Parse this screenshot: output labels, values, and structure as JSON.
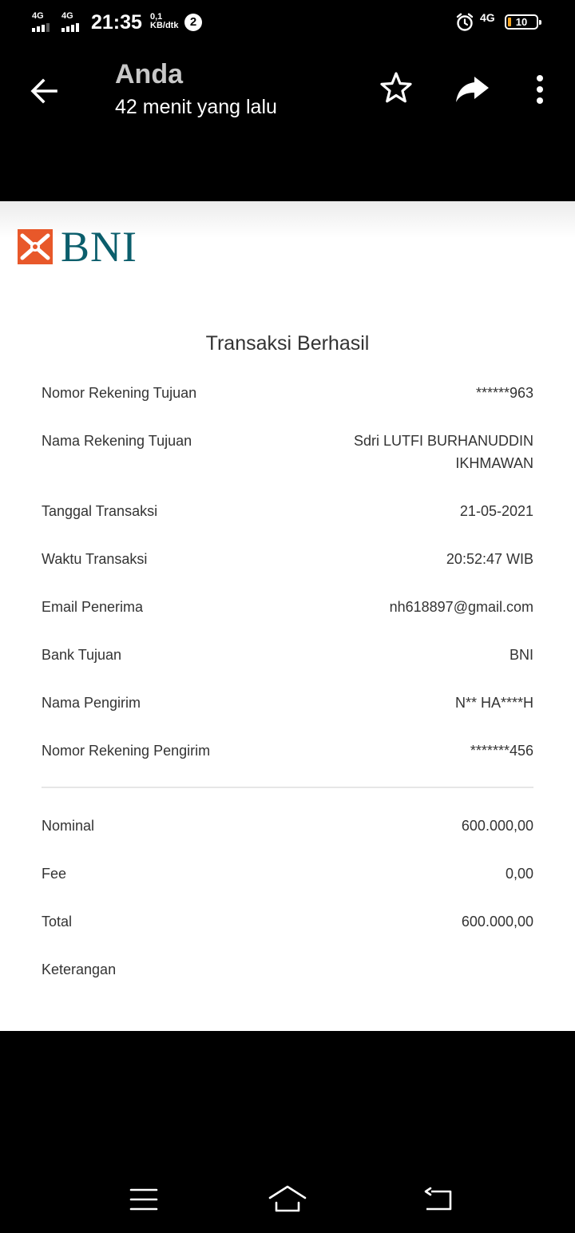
{
  "status_bar": {
    "sim1_label": "4G",
    "sim2_label": "4G",
    "time": "21:35",
    "speed_value": "0,1",
    "speed_unit": "KB/dtk",
    "notification_count": "2",
    "network_label": "4G",
    "battery_level": "10",
    "icons": [
      "signal-icon",
      "signal-icon",
      "alarm-icon",
      "battery-icon"
    ]
  },
  "app_bar": {
    "title": "Anda",
    "subtitle": "42 menit yang lalu",
    "icons": [
      "back-arrow-icon",
      "star-icon",
      "share-icon",
      "more-vert-icon"
    ]
  },
  "document": {
    "logo_text": "BNI",
    "logo_colors": {
      "mark": "#e8582a",
      "text": "#0b5e6c"
    },
    "heading": "Transaksi Berhasil",
    "details": [
      {
        "label": "Nomor Rekening Tujuan",
        "value": "******963"
      },
      {
        "label": "Nama Rekening Tujuan",
        "value": "Sdri LUTFI BURHANUDDIN",
        "value2": "IKHMAWAN"
      },
      {
        "label": "Tanggal Transaksi",
        "value": "21-05-2021"
      },
      {
        "label": "Waktu Transaksi",
        "value": "20:52:47 WIB"
      },
      {
        "label": "Email Penerima",
        "value": "nh618897@gmail.com"
      },
      {
        "label": "Bank Tujuan",
        "value": "BNI"
      },
      {
        "label": "Nama Pengirim",
        "value": "N** HA****H"
      },
      {
        "label": "Nomor Rekening Pengirim",
        "value": "*******456"
      }
    ],
    "amounts": [
      {
        "label": "Nominal",
        "value": "600.000,00"
      },
      {
        "label": "Fee",
        "value": "0,00"
      },
      {
        "label": "Total",
        "value": "600.000,00"
      },
      {
        "label": "Keterangan",
        "value": ""
      }
    ]
  },
  "nav_bar": {
    "icons": [
      "menu-icon",
      "home-icon",
      "back-icon"
    ]
  }
}
